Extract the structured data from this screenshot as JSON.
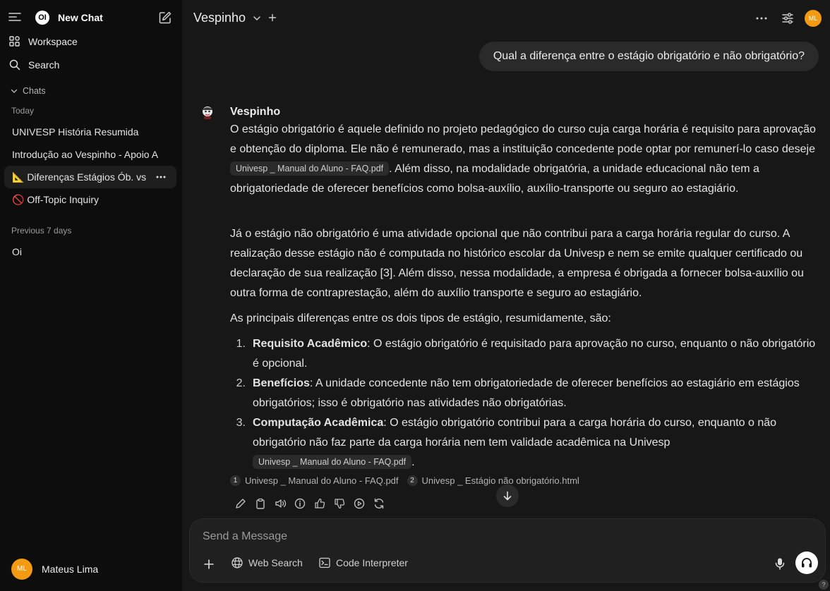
{
  "sidebar": {
    "new_chat": "New Chat",
    "logo_text": "OI",
    "workspace": "Workspace",
    "search": "Search",
    "chats_label": "Chats",
    "today_label": "Today",
    "previous_label": "Previous 7 days",
    "today_chats": [
      "UNIVESP História Resumida",
      "Introdução ao Vespinho - Apoio A",
      "📐 Diferenças Estágios Ób. vs",
      "🚫 Off-Topic Inquiry"
    ],
    "previous_chats": [
      "Oi"
    ],
    "user": {
      "initials": "ML",
      "name": "Mateus Lima"
    }
  },
  "header": {
    "model": "Vespinho",
    "avatar_initials": "ML"
  },
  "conversation": {
    "user_message": "Qual a diferença entre o estágio obrigatório e não obrigatório?",
    "assistant_name": "Vespinho",
    "p1_before": "O estágio obrigatório é aquele definido no projeto pedagógico do curso cuja carga horária é requisito para aprovação e obtenção do diploma. Ele não é remunerado, mas a instituição concedente pode optar por remunerí-lo caso deseje ",
    "p1_chip": "Univesp _ Manual do Aluno - FAQ.pdf",
    "p1_after": ". Além disso, na modalidade obrigatória, a unidade educacional não tem a obrigatoriedade de oferecer benefícios como bolsa-auxílio, auxílio-transporte ou seguro ao estagiário.",
    "p2": "Já o estágio não obrigatório é uma atividade opcional que não contribui para a carga horária regular do curso. A realização desse estágio não é computada no histórico escolar da Univesp e nem se emite qualquer certificado ou declaração de sua realização [3]. Além disso, nessa modalidade, a empresa é obrigada a fornecer bolsa-auxílio ou outra forma de contraprestação, além do auxílio transporte e seguro ao estagiário.",
    "p3": "As principais diferenças entre os dois tipos de estágio, resumidamente, são:",
    "list": [
      {
        "num": "1.",
        "title": "Requisito Acadêmico",
        "text": ": O estágio obrigatório é requisitado para aprovação no curso, enquanto o não obrigatório é opcional."
      },
      {
        "num": "2.",
        "title": "Benefícios",
        "text": ": A unidade concedente não tem obrigatoriedade de oferecer benefícios ao estagiário em estágios obrigatórios; isso é obrigatório nas atividades não obrigatórias."
      },
      {
        "num": "3.",
        "title": "Computação Acadêmica",
        "text": ": O estágio obrigatório contribui para a carga horária do curso, enquanto o não obrigatório não faz parte da carga horária nem tem validade acadêmica na Univesp",
        "chip": "Univesp _ Manual do Aluno - FAQ.pdf",
        "after": "."
      }
    ],
    "sources": [
      {
        "num": "1",
        "label": "Univesp _ Manual do Aluno - FAQ.pdf"
      },
      {
        "num": "2",
        "label": "Univesp _ Estágio não obrigatório.html"
      }
    ]
  },
  "composer": {
    "placeholder": "Send a Message",
    "web_search": "Web Search",
    "code_interpreter": "Code Interpreter"
  },
  "help": "?",
  "colors": {
    "accent_avatar": "#f29a12",
    "background": "#171717",
    "sidebar": "#0d0d0d"
  }
}
